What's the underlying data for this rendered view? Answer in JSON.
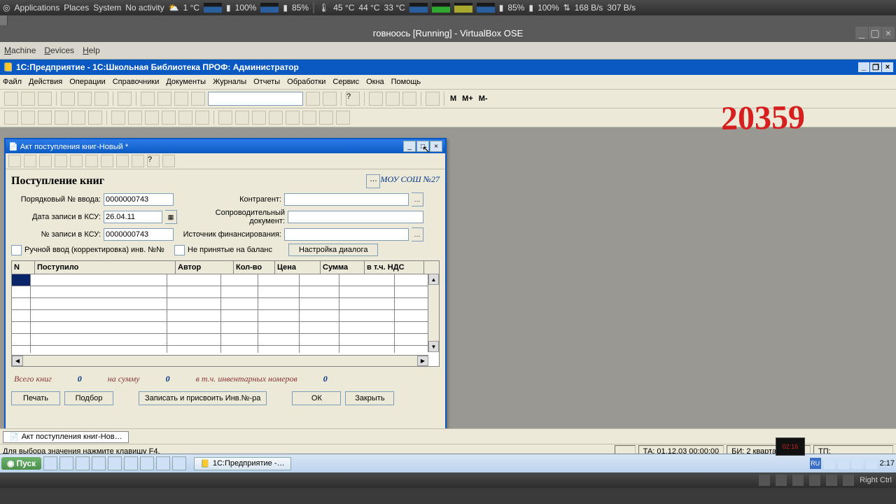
{
  "gnome_panel": {
    "apps": "Applications",
    "places": "Places",
    "system": "System",
    "noact": "No activity",
    "temp_out": "1 °C",
    "batt1": "100%",
    "batt2": "85%",
    "cpu_t1": "45 °C",
    "cpu_t2": "44 °C",
    "cpu_t3": "33 °C",
    "batt3": "85%",
    "batt4": "100%",
    "net_down": "168 B/s",
    "net_up": "307 B/s"
  },
  "vbox": {
    "title": "говноось [Running] - VirtualBox OSE",
    "menu": {
      "machine": "Machine",
      "devices": "Devices",
      "help": "Help"
    }
  },
  "onec": {
    "apptitle": "1С:Предприятие - 1С:Школьная Библиотека ПРОФ:  Администратор",
    "menu": [
      "Файл",
      "Действия",
      "Операции",
      "Справочники",
      "Документы",
      "Журналы",
      "Отчеты",
      "Обработки",
      "Сервис",
      "Окна",
      "Помощь"
    ],
    "tb_m": "M",
    "tb_mp": "M+",
    "tb_mm": "M-",
    "mdi": {
      "title": "Акт поступления книг-Новый *",
      "heading": "Поступление книг",
      "school": "МОУ СОШ №27",
      "lbl_poryad": "Порядковый № ввода:",
      "val_poryad": "0000000743",
      "lbl_date": "Дата записи в КСУ:",
      "val_date": "26.04.11",
      "lbl_nksm": "№ записи в КСУ:",
      "val_nksm": "0000000743",
      "lbl_kontr": "Контрагент:",
      "lbl_doc": "Сопроводительный документ:",
      "lbl_ist": "Источник финансирования:",
      "cb_manual": "Ручной ввод (корректировка) инв. №№",
      "cb_notaccepted": "Не принятые на баланс",
      "btn_dialog": "Настройка диалога",
      "cols": [
        "N",
        "Поступило",
        "Автор",
        "Кол-во",
        "Цена",
        "Сумма",
        "в т.ч. НДС"
      ],
      "sum_books": "Всего книг",
      "sum_amount": "на сумму",
      "sum_inv": "в т.ч. инвентарных номеров",
      "zero": "0",
      "btns": {
        "print": "Печать",
        "pick": "Подбор",
        "save": "Записать и присвоить Инв.№-ра",
        "ok": "ОК",
        "close": "Закрыть"
      }
    },
    "mdi_tab": "Акт поступления книг-Нов…",
    "status_hint": "Для выбора значения нажмите клавишу F4.",
    "status_ta": "ТА: 01.12.03 00:00:00",
    "status_bi": "БИ: 2 квартал 2011 г.",
    "status_tp": "ТП:"
  },
  "handwriting": "20359",
  "win": {
    "start": "Пуск",
    "task": "1С:Предприятие -…",
    "time": "2:17",
    "lang": "RU",
    "vb_clock": "02:16"
  },
  "gnome_bottom": {
    "rightctrl": "Right Ctrl"
  }
}
